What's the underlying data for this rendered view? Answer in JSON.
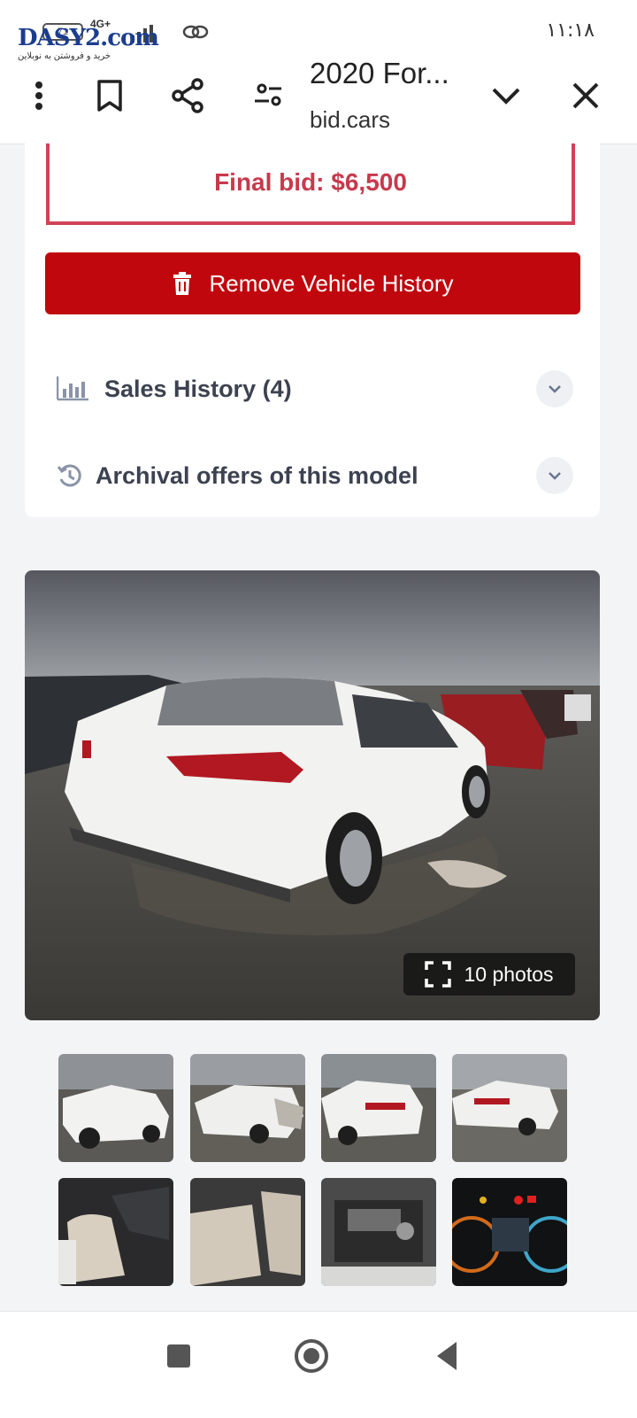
{
  "status": {
    "time": "١١:١٨",
    "battery": "71",
    "network": "4G+",
    "watermark_brand": "DASY2.com",
    "watermark_sub": "خرید و فروشتن به نوبلاین"
  },
  "header": {
    "title": "2020 For...",
    "url": "bid.cars",
    "icons": [
      "more-vert-icon",
      "bookmark-icon",
      "share-icon",
      "settings-sliders-icon",
      "chevron-down-icon",
      "close-icon"
    ]
  },
  "auction": {
    "final_bid": "Final bid: $6,500",
    "remove_label": "Remove Vehicle History"
  },
  "accordions": {
    "sales_history": "Sales History (4)",
    "archival_offers": "Archival offers of this model"
  },
  "gallery": {
    "photos_label": "10 photos",
    "thumbnails": [
      "front-left exterior",
      "front damage",
      "rear-right exterior",
      "rear-left exterior",
      "front seats interior",
      "rear seats interior",
      "engine bay",
      "instrument cluster"
    ]
  },
  "colors": {
    "accent_red": "#c0070d",
    "final_bid_red": "#c8394c",
    "car_body": "#f2f2f0"
  }
}
